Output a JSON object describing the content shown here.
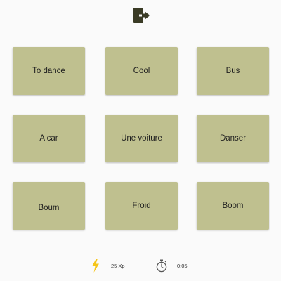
{
  "header": {
    "exit_icon": "exit-door-icon",
    "exit_color": "#3a3b25"
  },
  "cards": [
    {
      "label": "To dance"
    },
    {
      "label": "Cool"
    },
    {
      "label": "Bus"
    },
    {
      "label": "A car"
    },
    {
      "label": "Une voiture"
    },
    {
      "label": "Danser"
    },
    {
      "label": "Boum"
    },
    {
      "label": "Froid"
    },
    {
      "label": "Boom"
    }
  ],
  "card_color": "#bfc08f",
  "footer": {
    "xp_icon": "lightning-bolt-icon",
    "xp_label": "25 Xp",
    "xp_color": "#f5c518",
    "timer_icon": "stopwatch-icon",
    "timer_label": "0:05"
  }
}
